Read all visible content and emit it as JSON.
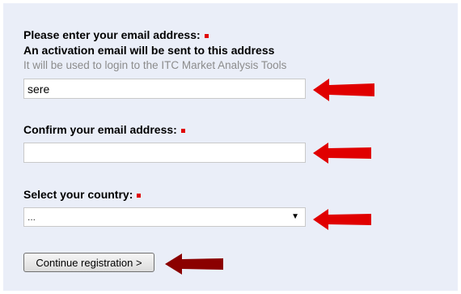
{
  "form": {
    "email_label": "Please enter your email address:",
    "activation_note": "An activation email will be sent to this address",
    "usage_hint": "It will be used to login to the ITC Market Analysis Tools",
    "email_value": "sere",
    "email_placeholder": "",
    "confirm_label": "Confirm your email address:",
    "confirm_value": "",
    "country_label": "Select your country:",
    "country_selected": "...",
    "continue_label": "Continue registration >"
  },
  "colors": {
    "required_marker": "#e00000",
    "annotation_arrow": "#e00000",
    "annotation_arrow_dark": "#8b0000",
    "panel_background": "#eaeef8"
  },
  "icons": {
    "required": "red-square",
    "select_caret": "down-triangle",
    "annotation": "left-pointing-arrow"
  }
}
